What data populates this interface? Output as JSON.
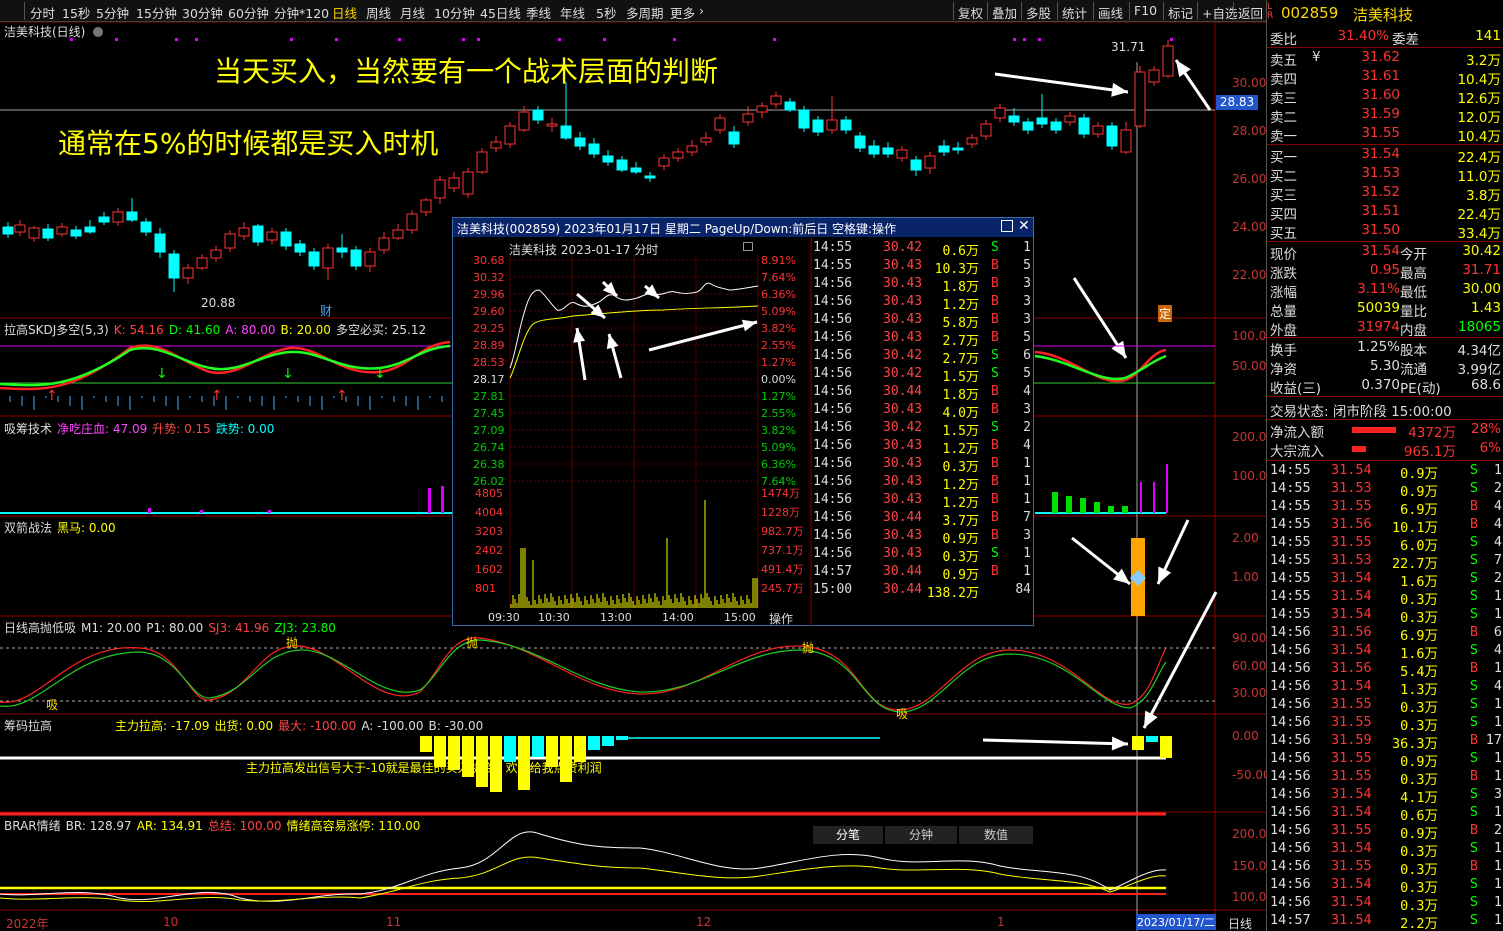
{
  "colors": {
    "up": "#ff3333",
    "down": "#00ffff",
    "yellow": "#ffff00",
    "white": "#ffffff",
    "green": "#00ff00"
  },
  "toolbar": {
    "periods": [
      "分时",
      "15秒",
      "5分钟",
      "15分钟",
      "30分钟",
      "60分钟",
      "分钟*120",
      "日线",
      "周线",
      "月线",
      "10分钟",
      "45日线",
      "季线",
      "年线",
      "5秒",
      "多周期",
      "更多"
    ],
    "active_period": "日线",
    "tools": [
      "复权",
      "叠加",
      "多股",
      "统计",
      "画线",
      "F10",
      "标记",
      "+自选",
      "返回"
    ]
  },
  "chart_title": "洁美科技(日线)",
  "annotations": {
    "line1": "当天买入，当然要有一个战术层面的判断",
    "line2": "通常在5%的时候都是买入时机"
  },
  "price_axis": [
    "30.00",
    "28.00",
    "26.00",
    "24.00",
    "22.00"
  ],
  "price_marks": {
    "current": "28.83",
    "high": "31.71",
    "low": "20.88",
    "cai": "财",
    "ding": "定"
  },
  "panels": {
    "skdj": {
      "name": "拉高SKDJ多空(5,3)",
      "K": "K: 54.16",
      "D": "D: 41.60",
      "A": "A: 80.00",
      "B": "B: 20.00",
      "dk": "多空必买: 25.12",
      "axis": [
        "100.0",
        "50.00"
      ]
    },
    "xichou": {
      "name": "吸筹技术",
      "a": "净吃庄血: 47.09",
      "b": "升势: 0.15",
      "c": "跌势: 0.00",
      "axis": [
        "200.0",
        "100.0"
      ]
    },
    "shuangjian": {
      "name": "双箭战法",
      "a": "黑马: 0.00",
      "axis": [
        "2.00",
        "1.00"
      ]
    },
    "gaopao": {
      "name": "日线高抛低吸",
      "m1": "M1: 20.00",
      "p1": "P1: 80.00",
      "sj3": "SJ3: 41.96",
      "zj3": "ZJ3: 23.80",
      "axis": [
        "90.00",
        "60.00",
        "30.00"
      ],
      "labels": {
        "pao": "抛",
        "xi": "吸"
      }
    },
    "choumalagao": {
      "name": "筹码拉高",
      "a": "主力拉高: -17.09",
      "b": "出货: 0.00",
      "c": "最大: -100.00",
      "d": "A: -100.00",
      "e": "B: -30.00",
      "note": "主力拉高发出信号大于-10就是最佳的买入机会，欢迎给我点赞利润",
      "axis": [
        "0.00",
        "-50.00"
      ]
    },
    "brar": {
      "name": "BRAR情绪",
      "br": "BR: 128.97",
      "ar": "AR: 134.91",
      "zj": "总结: 100.00",
      "qx": "情绪高容易涨停: 110.00",
      "axis": [
        "200.0",
        "150.0",
        "100.0"
      ]
    }
  },
  "date_axis": [
    "2022年",
    "10",
    "11",
    "12",
    "1"
  ],
  "date_cursor": "2023/01/17/二",
  "period_label": "日线",
  "popup": {
    "title": "洁美科技(002859)  2023年01月17日  星期二  PageUp/Down:前后日  空格键:操作",
    "sub_title": "洁美科技  2023-01-17 分时",
    "price_axis": [
      "30.68",
      "30.32",
      "29.96",
      "29.60",
      "29.25",
      "28.89",
      "28.53",
      "28.17",
      "27.81",
      "27.45",
      "27.09",
      "26.74",
      "26.38",
      "26.02"
    ],
    "pct_axis": [
      "8.91%",
      "7.64%",
      "6.36%",
      "5.09%",
      "3.82%",
      "2.55%",
      "1.27%",
      "0.00%",
      "1.27%",
      "2.55%",
      "3.82%",
      "5.09%",
      "6.36%",
      "7.64%"
    ],
    "vol_axis": [
      "4805",
      "4004",
      "3203",
      "2402",
      "1602",
      "801"
    ],
    "vol_axis_r": [
      "1474万",
      "1228万",
      "982.7万",
      "737.1万",
      "491.4万",
      "245.7万"
    ],
    "time_axis": [
      "09:30",
      "10:30",
      "13:00",
      "14:00",
      "15:00"
    ],
    "op_label": "操作",
    "tabs": [
      "分笔",
      "分钟",
      "数值"
    ],
    "ticks": [
      [
        "14:55",
        "30.42",
        "0.6万",
        "S",
        "1"
      ],
      [
        "14:55",
        "30.43",
        "10.3万",
        "B",
        "5"
      ],
      [
        "14:56",
        "30.43",
        "1.8万",
        "B",
        "3"
      ],
      [
        "14:56",
        "30.43",
        "1.2万",
        "B",
        "3"
      ],
      [
        "14:56",
        "30.43",
        "5.8万",
        "B",
        "3"
      ],
      [
        "14:56",
        "30.43",
        "2.7万",
        "B",
        "5"
      ],
      [
        "14:56",
        "30.42",
        "2.7万",
        "S",
        "6"
      ],
      [
        "14:56",
        "30.42",
        "1.5万",
        "S",
        "5"
      ],
      [
        "14:56",
        "30.44",
        "1.8万",
        "B",
        "4"
      ],
      [
        "14:56",
        "30.43",
        "4.0万",
        "B",
        "3"
      ],
      [
        "14:56",
        "30.42",
        "1.5万",
        "S",
        "2"
      ],
      [
        "14:56",
        "30.43",
        "1.2万",
        "B",
        "4"
      ],
      [
        "14:56",
        "30.43",
        "0.3万",
        "B",
        "1"
      ],
      [
        "14:56",
        "30.43",
        "1.2万",
        "B",
        "1"
      ],
      [
        "14:56",
        "30.43",
        "1.2万",
        "B",
        "1"
      ],
      [
        "14:56",
        "30.44",
        "3.7万",
        "B",
        "7"
      ],
      [
        "14:56",
        "30.43",
        "0.9万",
        "B",
        "3"
      ],
      [
        "14:56",
        "30.43",
        "0.3万",
        "S",
        "1"
      ],
      [
        "14:57",
        "30.44",
        "0.9万",
        "B",
        "1"
      ],
      [
        "15:00",
        "30.44",
        "138.2万",
        "",
        "84"
      ]
    ]
  },
  "side": {
    "code": "002859",
    "name": "洁美科技",
    "weibi": {
      "label": "委比",
      "value": "31.40%",
      "label2": "委差",
      "value2": "141"
    },
    "sells": [
      [
        "卖五",
        "¥",
        "31.62",
        "3.2万"
      ],
      [
        "卖四",
        "",
        "31.61",
        "10.4万"
      ],
      [
        "卖三",
        "",
        "31.60",
        "12.6万"
      ],
      [
        "卖二",
        "",
        "31.59",
        "12.0万"
      ],
      [
        "卖一",
        "",
        "31.55",
        "10.4万"
      ]
    ],
    "buys": [
      [
        "买一",
        "31.54",
        "22.4万"
      ],
      [
        "买二",
        "31.53",
        "11.0万"
      ],
      [
        "买三",
        "31.52",
        "3.8万"
      ],
      [
        "买四",
        "31.51",
        "22.4万"
      ],
      [
        "买五",
        "31.50",
        "33.4万"
      ]
    ],
    "stats": [
      [
        "现价",
        "31.54",
        "今开",
        "30.42"
      ],
      [
        "涨跌",
        "0.95",
        "最高",
        "31.71"
      ],
      [
        "涨幅",
        "3.11%",
        "最低",
        "30.00"
      ],
      [
        "总量",
        "50039",
        "量比",
        "1.43"
      ],
      [
        "外盘",
        "31974",
        "内盘",
        "18065"
      ],
      [
        "换手",
        "1.25%",
        "股本",
        "4.34亿"
      ],
      [
        "净资",
        "5.30",
        "流通",
        "3.99亿"
      ],
      [
        "收益(三)",
        "0.370",
        "PE(动)",
        "68.6"
      ]
    ],
    "status": "交易状态: 闭市阶段 15:00:00",
    "flows": [
      [
        "净流入额",
        "4372万",
        "28%"
      ],
      [
        "大宗流入",
        "965.1万",
        "6%"
      ]
    ],
    "ticks": [
      [
        "14:55",
        "31.54",
        "0.9万",
        "S",
        "1"
      ],
      [
        "14:55",
        "31.53",
        "0.9万",
        "S",
        "2"
      ],
      [
        "14:55",
        "31.55",
        "6.9万",
        "B",
        "4"
      ],
      [
        "14:55",
        "31.56",
        "10.1万",
        "B",
        "4"
      ],
      [
        "14:55",
        "31.55",
        "6.0万",
        "S",
        "4"
      ],
      [
        "14:55",
        "31.53",
        "22.7万",
        "S",
        "7"
      ],
      [
        "14:55",
        "31.54",
        "1.6万",
        "S",
        "2"
      ],
      [
        "14:55",
        "31.54",
        "0.3万",
        "S",
        "1"
      ],
      [
        "14:55",
        "31.54",
        "0.3万",
        "S",
        "1"
      ],
      [
        "14:56",
        "31.56",
        "6.9万",
        "B",
        "6"
      ],
      [
        "14:56",
        "31.54",
        "1.6万",
        "S",
        "4"
      ],
      [
        "14:56",
        "31.56",
        "5.4万",
        "B",
        "1"
      ],
      [
        "14:56",
        "31.54",
        "1.3万",
        "S",
        "4"
      ],
      [
        "14:56",
        "31.55",
        "0.3万",
        "S",
        "1"
      ],
      [
        "14:56",
        "31.55",
        "0.3万",
        "S",
        "1"
      ],
      [
        "14:56",
        "31.59",
        "36.3万",
        "B",
        "17"
      ],
      [
        "14:56",
        "31.55",
        "0.9万",
        "S",
        "1"
      ],
      [
        "14:56",
        "31.55",
        "0.3万",
        "B",
        "1"
      ],
      [
        "14:56",
        "31.54",
        "4.1万",
        "S",
        "3"
      ],
      [
        "14:56",
        "31.54",
        "0.6万",
        "S",
        "1"
      ],
      [
        "14:56",
        "31.55",
        "0.9万",
        "B",
        "2"
      ],
      [
        "14:56",
        "31.54",
        "0.3万",
        "S",
        "1"
      ],
      [
        "14:56",
        "31.55",
        "0.3万",
        "B",
        "1"
      ],
      [
        "14:56",
        "31.54",
        "0.3万",
        "S",
        "1"
      ],
      [
        "14:56",
        "31.54",
        "0.3万",
        "S",
        "1"
      ],
      [
        "14:57",
        "31.54",
        "2.2万",
        "S",
        "1"
      ]
    ]
  }
}
